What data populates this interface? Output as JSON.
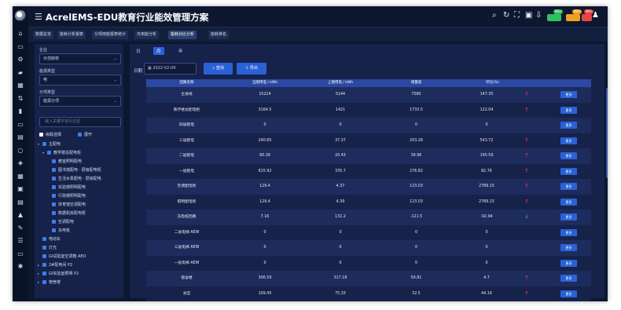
{
  "app": {
    "title": "AcrelEMS-EDU教育行业能效管理方案"
  },
  "colors": {
    "accent": "#2a62d6",
    "up_trend": "#e64545",
    "down_trend": "#46c15f",
    "badge_green": "#2fbf5f",
    "badge_orange": "#f0a020",
    "badge_red": "#e64545"
  },
  "header_tools": [
    "search-icon",
    "refresh-icon",
    "fullscreen-icon",
    "image-icon",
    "download-icon"
  ],
  "header_badges": [
    {
      "label": "99+",
      "color": "#2fbf5f"
    },
    {
      "label": "99+",
      "color": "#f0a020"
    },
    {
      "label": "99+",
      "color": "#e64545"
    }
  ],
  "page_tabs": [
    "数据总览",
    "能耗分析报表",
    "分项用能报表统计",
    "日用能分析",
    "能耗对比分析",
    "能耗排名"
  ],
  "sidebar": {
    "label_1": "企业",
    "select_1": "示范院校",
    "label_2": "能源类型",
    "select_2": "电",
    "label_3": "分项类型",
    "select_3": "能源分项",
    "search_placeholder": "输入关键字进行过滤",
    "check_all": "级联选择",
    "expand_all": "展开",
    "tree": [
      {
        "label": "主配电",
        "level": 0
      },
      {
        "label": "教学楼总配电柜",
        "level": 1
      },
      {
        "label": "教室照明配电",
        "level": 2
      },
      {
        "label": "图书馆配电 · 层级配电柜",
        "level": 2
      },
      {
        "label": "生活水泵配电 · 层级配电",
        "level": 2
      },
      {
        "label": "实验楼照明配电",
        "level": 2
      },
      {
        "label": "行政楼照明配电",
        "level": 2
      },
      {
        "label": "体育馆空调配电",
        "level": 2
      },
      {
        "label": "数据机房配电柜",
        "level": 2
      },
      {
        "label": "空调配电",
        "level": 2
      },
      {
        "label": "充电桩",
        "level": 2
      },
      {
        "label": "电动车",
        "level": 1
      },
      {
        "label": "灯光",
        "level": 1
      },
      {
        "label": "GI试验室空调箱 AEO",
        "level": 1
      },
      {
        "label": "2#配电间 P2",
        "level": 1
      },
      {
        "label": "GI实验室照明 P2",
        "level": 1
      },
      {
        "label": "宿舍楼",
        "level": 1
      }
    ]
  },
  "main": {
    "tabs": [
      "日",
      "月",
      "年"
    ],
    "date_label": "日期",
    "date_value": "2022-02-09",
    "query_label": "查询",
    "export_label": "导出",
    "columns": [
      "回路名称",
      "当期用电 / kWh",
      "上期用电 / kWh",
      "增量值",
      "环比(%)",
      ""
    ],
    "detail_label": "更多",
    "rows": [
      {
        "name": "主进线",
        "cur": "15224",
        "prev": "5144",
        "delta": "7580",
        "pct": "147.35",
        "trend": "up"
      },
      {
        "name": "教学楼总配电柜",
        "cur": "3164.5",
        "prev": "1421",
        "delta": "1733.5",
        "pct": "122.04",
        "trend": "up"
      },
      {
        "name": "四层配电",
        "cur": "0",
        "prev": "0",
        "delta": "0",
        "pct": "0",
        "trend": ""
      },
      {
        "name": "三层配电",
        "cur": "240.65",
        "prev": "37.37",
        "delta": "203.28",
        "pct": "543.72",
        "trend": "up"
      },
      {
        "name": "二层配电",
        "cur": "60.39",
        "prev": "20.43",
        "delta": "39.96",
        "pct": "195.59",
        "trend": "up"
      },
      {
        "name": "一层配电",
        "cur": "615.92",
        "prev": "335.7",
        "delta": "276.82",
        "pct": "82.76",
        "trend": "up"
      },
      {
        "name": "空调配电柜",
        "cur": "129.4",
        "prev": "4.37",
        "delta": "123.03",
        "pct": "2789.15",
        "trend": "up"
      },
      {
        "name": "照明配电柜",
        "cur": "129.4",
        "prev": "4.39",
        "delta": "123.03",
        "pct": "2789.15",
        "trend": "up"
      },
      {
        "name": "充电桩回路",
        "cur": "7.16",
        "prev": "132.2",
        "delta": "-121.5",
        "pct": "-92.94",
        "trend": "down"
      },
      {
        "name": "二层电梯 AEW",
        "cur": "0",
        "prev": "0",
        "delta": "0",
        "pct": "0",
        "trend": ""
      },
      {
        "name": "三层电梯 AEW",
        "cur": "0",
        "prev": "0",
        "delta": "0",
        "pct": "0",
        "trend": ""
      },
      {
        "name": "一层电梯 AEW",
        "cur": "0",
        "prev": "0",
        "delta": "0",
        "pct": "0",
        "trend": ""
      },
      {
        "name": "宿舍楼",
        "cur": "306.59",
        "prev": "317.18",
        "delta": "59.81",
        "pct": "4.7",
        "trend": "up"
      },
      {
        "name": "食堂",
        "cur": "109.45",
        "prev": "75.33",
        "delta": "32.5",
        "pct": "44.19",
        "trend": "up"
      }
    ]
  }
}
